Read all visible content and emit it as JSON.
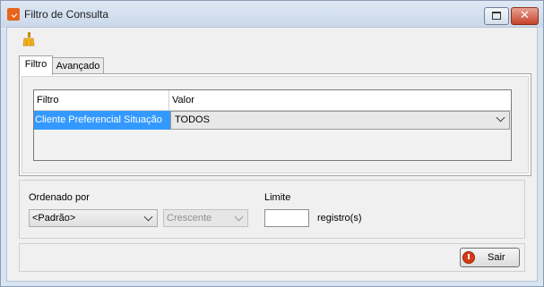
{
  "window": {
    "title": "Filtro de Consulta"
  },
  "tabs": [
    {
      "label": "Filtro"
    },
    {
      "label": "Avançado"
    }
  ],
  "grid": {
    "columns": [
      "Filtro",
      "Valor"
    ],
    "rows": [
      {
        "filter": "Cliente Preferencial Situação",
        "value": "TODOS"
      }
    ]
  },
  "ordering": {
    "label": "Ordenado por",
    "field_selected": "<Padrão>",
    "direction_selected": "Crescente"
  },
  "limit": {
    "label": "Limite",
    "value": "",
    "unit": "registro(s)"
  },
  "actions": {
    "exit_label": "Sair"
  },
  "colors": {
    "selection": "#3399ff",
    "exit_icon": "#d63a16",
    "app_icon": "#e8641c"
  }
}
